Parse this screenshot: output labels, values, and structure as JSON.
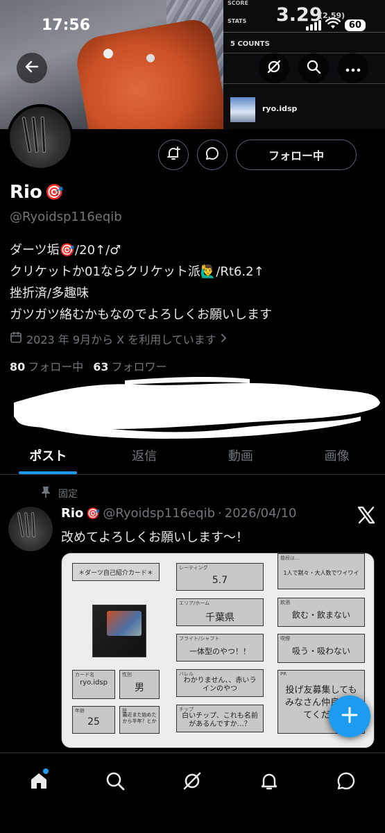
{
  "status_bar": {
    "time": "17:56",
    "battery": "60"
  },
  "banner": {
    "screen_score": "SCORE",
    "screen_stats": "STATS",
    "screen_big_value": "3.29",
    "screen_small_value": "(2.59)",
    "screen_counts": "5 COUNTS",
    "screen_filename": "ryo.idsp"
  },
  "profile": {
    "name": "Rio",
    "handle": "@Ryoidsp116eqib",
    "bio": [
      "ダーツ垢🎯/20↑/♂",
      "クリケットか01ならクリケット派🙋‍♂️/Rt6.2↑",
      "挫折済/多趣味",
      "ガツガツ絡むかもなのでよろしくお願いします"
    ],
    "joined": "2023 年 9月から X を利用しています",
    "following_count": "80",
    "following_label": "フォロー中",
    "followers_count": "63",
    "followers_label": "フォロワー",
    "follow_button": "フォロー中"
  },
  "tabs": [
    {
      "label": "ポスト",
      "active": true
    },
    {
      "label": "返信",
      "active": false
    },
    {
      "label": "動画",
      "active": false
    },
    {
      "label": "画像",
      "active": false
    }
  ],
  "post": {
    "pinned_label": "固定",
    "author": "Rio",
    "handle": "@Ryoidsp116eqib",
    "separator": "·",
    "date": "2026/04/10",
    "text": "改めてよろしくお願いします〜！"
  },
  "card": {
    "title": "＊ダーツ自己紹介カード＊",
    "rating_label": "レーティング",
    "rating_value": "5.7",
    "area_label": "エリア/ホーム",
    "area_value": "千葉県",
    "flight_label": "フライト/シャフト",
    "flight_value": "一体型のやつ！！",
    "barrel_label": "バレル",
    "barrel_value": "わかりません、、赤いラインのやつ",
    "tip_label": "チップ",
    "tip_value": "白いチップ、これも名前があるんですか…？",
    "card_name_label": "カード名",
    "card_name_value": "ryo.idsp",
    "gender_label": "性別",
    "gender_value": "男",
    "age_label": "年齢",
    "age_value": "25",
    "history_label": "歴",
    "history_value": "最近また始めたから半年？とか",
    "usual_label": "普段は…",
    "usual_value": "1人で黙々・大人数でワイワイ",
    "drink_label": "飲酒",
    "drink_value": "飲む・飲まない",
    "smoke_label": "喫煙",
    "smoke_value": "吸う・吸わない",
    "pr_label": "PR",
    "pr_value": "投げ友募集してもみなさん仲良くしてくださ"
  },
  "colors": {
    "accent": "#1d9bf0",
    "muted": "#71767b",
    "background": "#000000"
  },
  "icons": {
    "back": "arrow-left-icon",
    "grok": "grok-icon",
    "search": "search-icon",
    "more": "more-icon",
    "notify": "bell-plus-icon",
    "message": "message-icon",
    "calendar": "calendar-icon",
    "pin": "pin-icon",
    "x_logo": "x-logo-icon",
    "compose": "plus-icon",
    "nav": [
      "home-icon",
      "search-icon",
      "grok-icon",
      "bell-icon",
      "messages-icon"
    ]
  }
}
